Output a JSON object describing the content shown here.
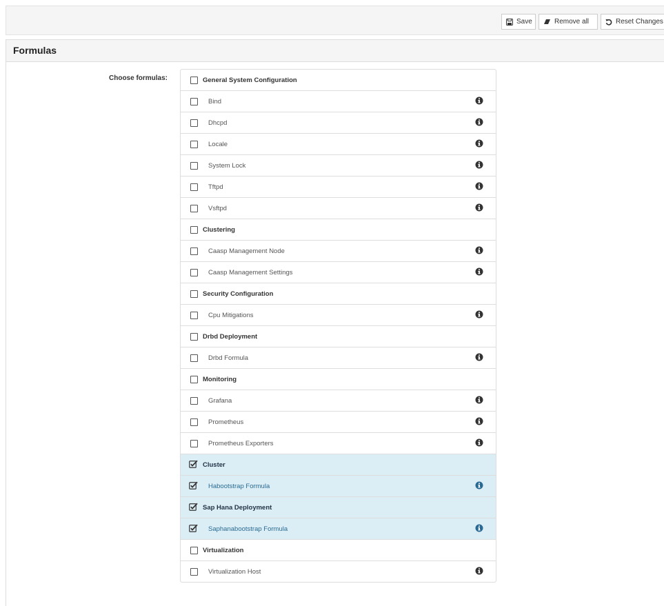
{
  "toolbar": {
    "save_label": "Save",
    "remove_label": "Remove all",
    "reset_label": "Reset Changes"
  },
  "panel": {
    "title": "Formulas",
    "choose_label": "Choose formulas:"
  },
  "colors": {
    "selected_bg": "#dbeef6",
    "selected_text": "#2a6a92"
  },
  "formulas": [
    {
      "label": "General System Configuration",
      "group": true,
      "checked": false
    },
    {
      "label": "Bind",
      "group": false,
      "checked": false
    },
    {
      "label": "Dhcpd",
      "group": false,
      "checked": false
    },
    {
      "label": "Locale",
      "group": false,
      "checked": false
    },
    {
      "label": "System Lock",
      "group": false,
      "checked": false
    },
    {
      "label": "Tftpd",
      "group": false,
      "checked": false
    },
    {
      "label": "Vsftpd",
      "group": false,
      "checked": false
    },
    {
      "label": "Clustering",
      "group": true,
      "checked": false
    },
    {
      "label": "Caasp Management Node",
      "group": false,
      "checked": false
    },
    {
      "label": "Caasp Management Settings",
      "group": false,
      "checked": false
    },
    {
      "label": "Security Configuration",
      "group": true,
      "checked": false
    },
    {
      "label": "Cpu Mitigations",
      "group": false,
      "checked": false
    },
    {
      "label": "Drbd Deployment",
      "group": true,
      "checked": false
    },
    {
      "label": "Drbd Formula",
      "group": false,
      "checked": false
    },
    {
      "label": "Monitoring",
      "group": true,
      "checked": false
    },
    {
      "label": "Grafana",
      "group": false,
      "checked": false
    },
    {
      "label": "Prometheus",
      "group": false,
      "checked": false
    },
    {
      "label": "Prometheus Exporters",
      "group": false,
      "checked": false
    },
    {
      "label": "Cluster",
      "group": true,
      "checked": true
    },
    {
      "label": "Habootstrap Formula",
      "group": false,
      "checked": true
    },
    {
      "label": "Sap Hana Deployment",
      "group": true,
      "checked": true
    },
    {
      "label": "Saphanabootstrap Formula",
      "group": false,
      "checked": true
    },
    {
      "label": "Virtualization",
      "group": true,
      "checked": false
    },
    {
      "label": "Virtualization Host",
      "group": false,
      "checked": false
    }
  ]
}
